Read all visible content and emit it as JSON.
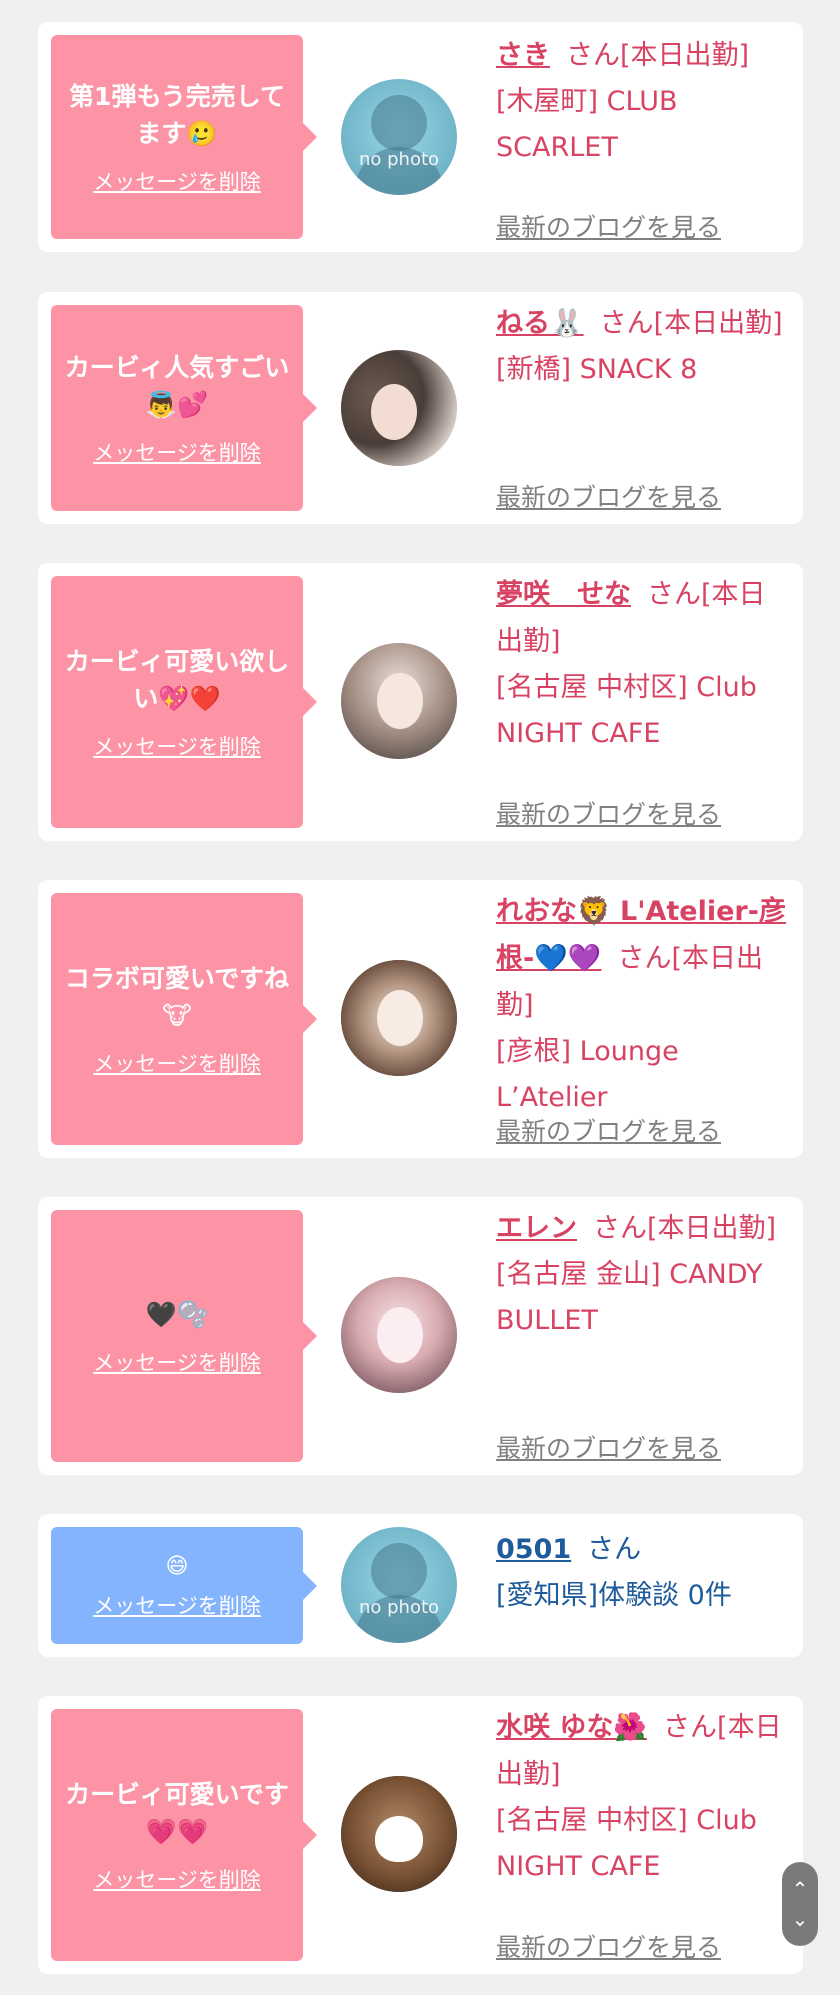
{
  "messages": [
    {
      "message": "第1弾もう完売してます🥲",
      "delete_label": "メッセージを削除",
      "name": "さき",
      "san_label": "さん[本日出勤]",
      "shop": "[木屋町] CLUB SCARLET",
      "blog_label": "最新のブログを見る",
      "avatar": "no photo"
    },
    {
      "message": "カービィ人気すごい👼💕",
      "delete_label": "メッセージを削除",
      "name": "ねる🐰",
      "san_label": "さん[本日出勤]",
      "shop": "[新橋] SNACK 8",
      "blog_label": "最新のブログを見る"
    },
    {
      "message": "カービィ可愛い欲しい💖❤️",
      "delete_label": "メッセージを削除",
      "name": "夢咲　せな",
      "san_label": "さん[本日出勤]",
      "shop": "[名古屋 中村区] Club NIGHT CAFE",
      "blog_label": "最新のブログを見る"
    },
    {
      "message": "コラボ可愛いですね🐮",
      "delete_label": "メッセージを削除",
      "name": "れおな🦁 L'Atelier-彦根-💙💜",
      "san_label": "さん[本日出勤]",
      "shop": "[彦根] Lounge L’Atelier",
      "blog_label": "最新のブログを見る"
    },
    {
      "message": "🖤🫧",
      "delete_label": "メッセージを削除",
      "name": "エレン",
      "san_label": "さん[本日出勤]",
      "shop": "[名古屋 金山] CANDY BULLET",
      "blog_label": "最新のブログを見る"
    },
    {
      "message": "😄",
      "delete_label": "メッセージを削除",
      "name": "0501",
      "san_label": "さん",
      "shop": "[愛知県]体験談 0件",
      "avatar": "no photo"
    },
    {
      "message": "カービィ可愛いです💗💗",
      "delete_label": "メッセージを削除",
      "name": "水咲 ゆな🌺",
      "san_label": "さん[本日出勤]",
      "shop": "[名古屋 中村区] Club NIGHT CAFE",
      "blog_label": "最新のブログを見る"
    }
  ],
  "scroll_control": {
    "up": "⌃",
    "down": "⌄"
  },
  "colors": {
    "pink_bubble": "#fd94a6",
    "blue_bubble": "#84b4fd",
    "name_pink": "#d84363",
    "name_blue": "#1e5b9a"
  }
}
